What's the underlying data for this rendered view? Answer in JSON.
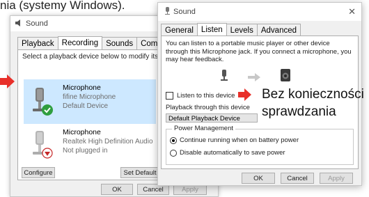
{
  "caption_fragment": "nia (systemy Windows).",
  "back_dialog": {
    "title": "Sound",
    "tabs": [
      "Playback",
      "Recording",
      "Sounds",
      "Commun"
    ],
    "instruction": "Select a playback device below to modify its sett",
    "devices": [
      {
        "name": "Microphone",
        "sub": "fifine Microphone",
        "status": "Default Device"
      },
      {
        "name": "Microphone",
        "sub": "Realtek High Definition Audio",
        "status": "Not plugged in"
      }
    ],
    "configure_label": "Configure",
    "set_default_label": "Set Default",
    "ok_label": "OK",
    "cancel_label": "Cancel",
    "apply_label": "Apply"
  },
  "front_dialog": {
    "title": "Sound",
    "tabs": [
      "General",
      "Listen",
      "Levels",
      "Advanced"
    ],
    "description": "You can listen to a portable music player or other device through this Microphone jack. If you connect a microphone, you may hear feedback.",
    "listen_checkbox_label": "Listen to this device",
    "playback_through_label": "Playback through this device",
    "playback_device": "Default Playback Device",
    "power_group_title": "Power Management",
    "radio_continue": "Continue running when on battery power",
    "radio_disable": "Disable automatically to save power",
    "ok_label": "OK",
    "cancel_label": "Cancel",
    "apply_label": "Apply"
  },
  "annotation": {
    "line1": "Bez konieczności",
    "line2": "sprawdzania",
    "arrow_color": "#e8302a"
  }
}
